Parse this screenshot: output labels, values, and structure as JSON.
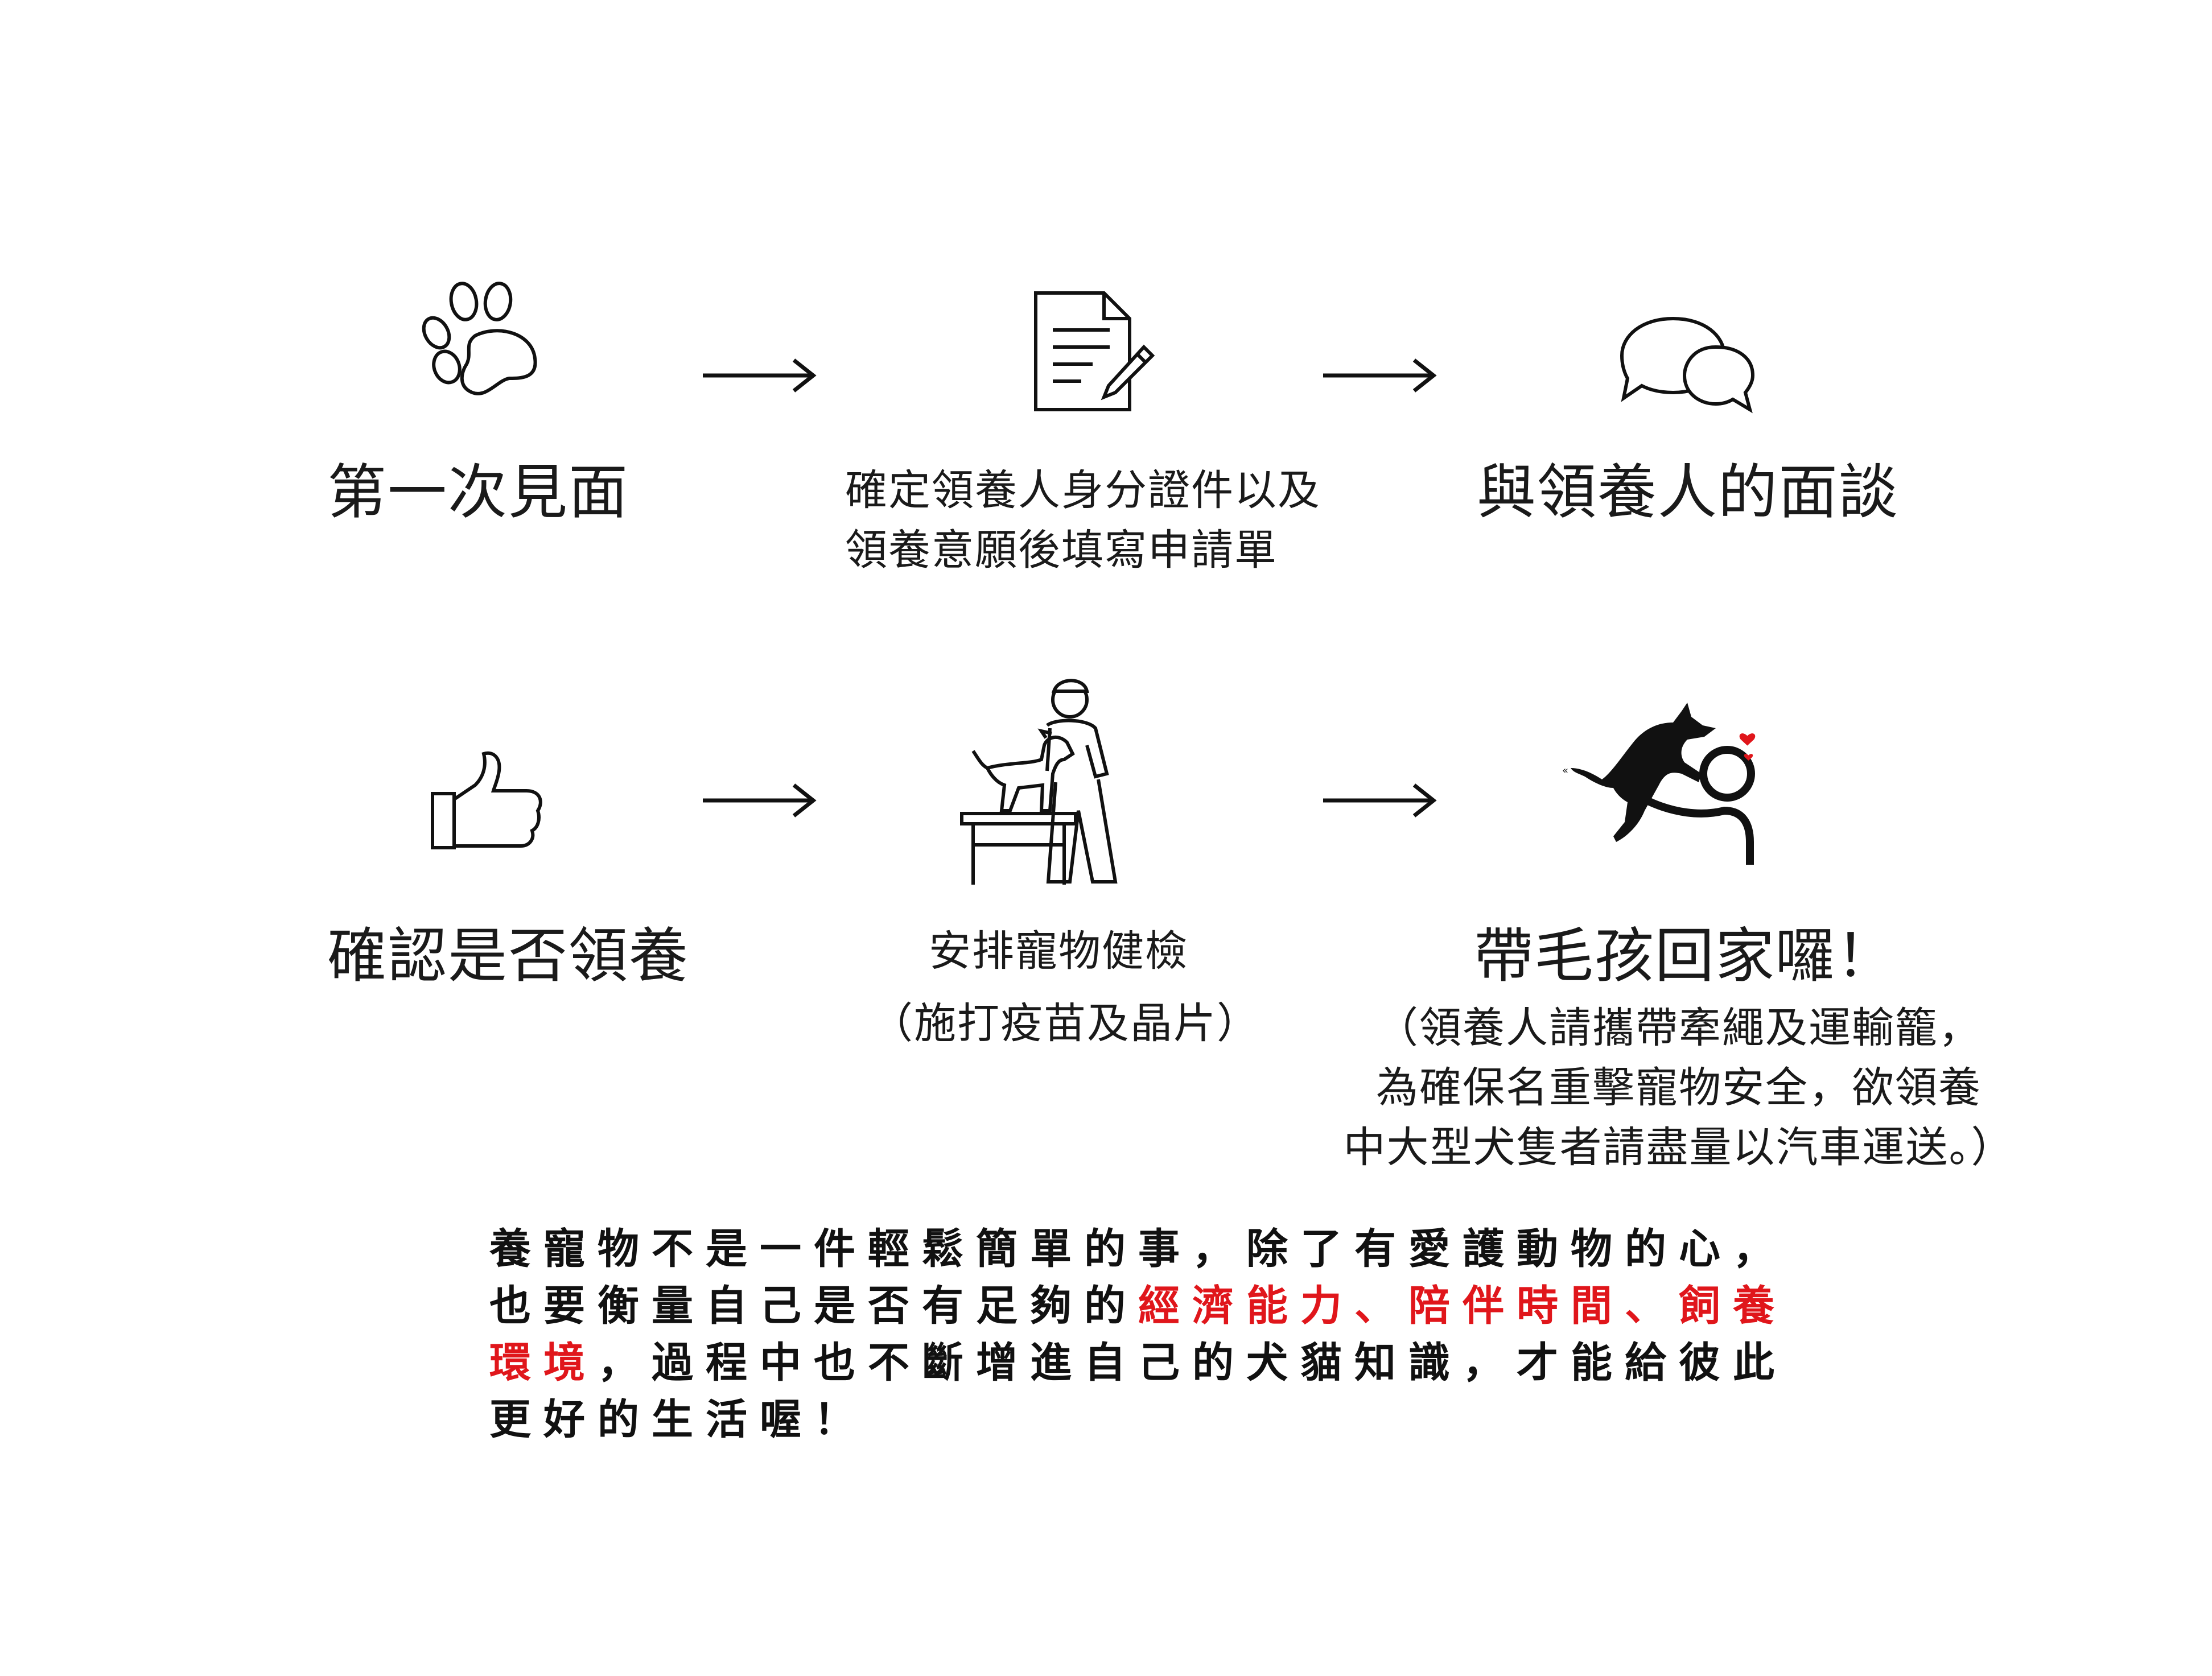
{
  "colors": {
    "text": "#1a1a1a",
    "highlight": "#e0161b",
    "heart": "#e0161b",
    "background": "#ffffff"
  },
  "steps": [
    {
      "icon": "paw-print-icon",
      "title": "第一次見面",
      "lines": []
    },
    {
      "icon": "document-pen-icon",
      "title": "",
      "lines": [
        "確定領養人身分證件以及",
        "領養意願後填寫申請單"
      ]
    },
    {
      "icon": "speech-bubbles-icon",
      "title": "與領養人的面談",
      "lines": []
    },
    {
      "icon": "thumbs-up-icon",
      "title": "確認是否領養",
      "lines": []
    },
    {
      "icon": "vet-exam-icon",
      "title": "",
      "lines": [
        "安排寵物健檢",
        "（施打疫苗及晶片）"
      ]
    },
    {
      "icon": "dog-hug-person-icon",
      "title": "帶毛孩回家囉！",
      "lines": [
        "（領養人請攜帶牽繩及運輸籠，",
        "為確保名重擊寵物安全，欲領養",
        "中大型犬隻者請盡量以汽車運送。）"
      ]
    }
  ],
  "arrows": [
    "right-arrow-icon",
    "right-arrow-icon",
    "right-arrow-icon",
    "right-arrow-icon"
  ],
  "closing": {
    "line1": "養寵物不是一件輕鬆簡單的事，除了有愛護動物的心，",
    "line2_a": "也要衡量自己是否有足夠的",
    "line2_b": "經濟能力",
    "line2_c": "、",
    "line2_d": "陪伴時間",
    "line2_e": "、",
    "line2_f": "飼養",
    "line3_a": "環境",
    "line3_b": "，過程中也不斷增進自己的犬貓知識，才能給彼此",
    "line4": "更好的生活喔！"
  }
}
